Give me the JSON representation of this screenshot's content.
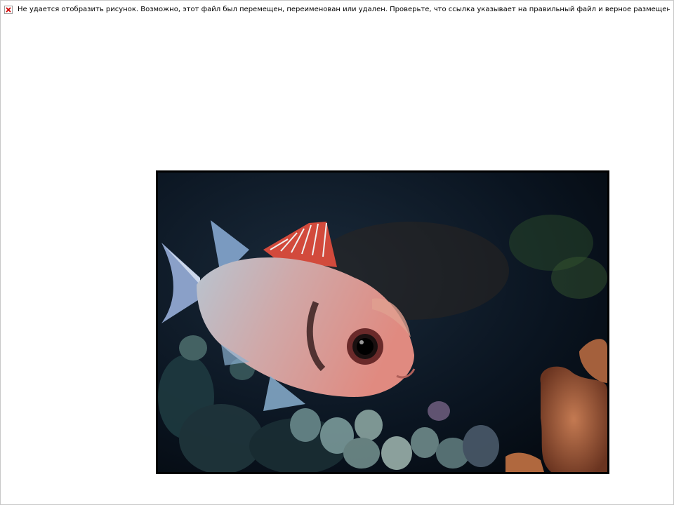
{
  "broken_image": {
    "icon": "broken-image-icon",
    "message": "Не удается отобразить рисунок. Возможно, этот файл был перемещен, переименован или удален. Проверьте, что ссылка указывает на правильный файл и верное размещение."
  },
  "photo": {
    "subject": "underwater-fish-photo",
    "colors": {
      "frame": "#000000",
      "water": "#0a1420",
      "fish_body": "#d88a82",
      "fish_fin": "#c8483c",
      "coral": "#b86a48"
    }
  }
}
